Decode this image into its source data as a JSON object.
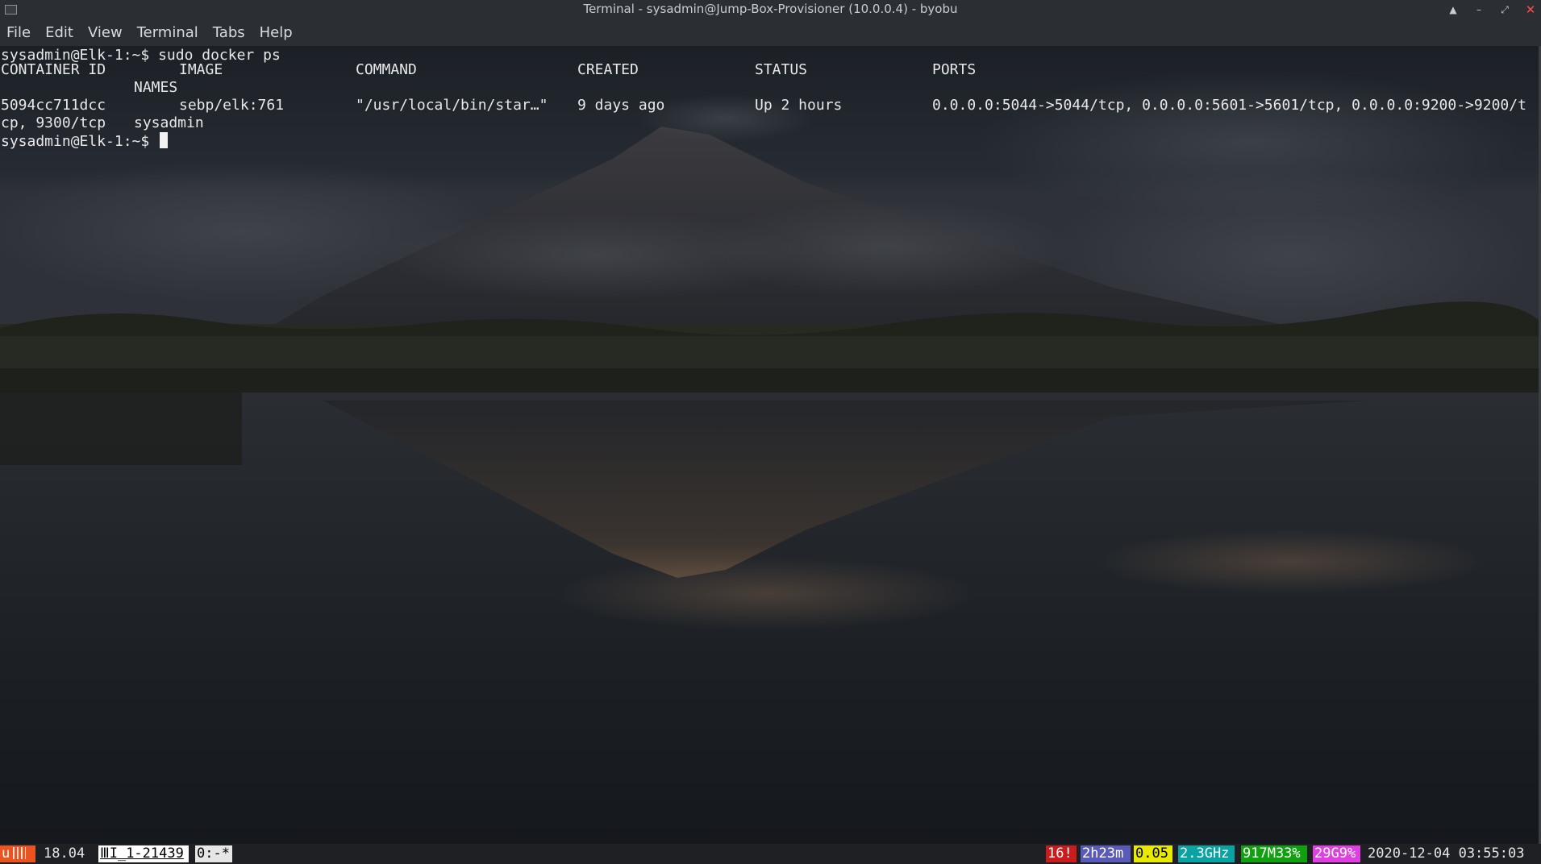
{
  "window": {
    "title": "Terminal - sysadmin@Jump-Box-Provisioner (10.0.0.4) - byobu",
    "buttons": {
      "up": "▲",
      "minimize": "–",
      "maximize": "⤢",
      "close": "✕"
    }
  },
  "menu": [
    "File",
    "Edit",
    "View",
    "Terminal",
    "Tabs",
    "Help"
  ],
  "terminal": {
    "prompt1": "sysadmin@Elk-1:~$ sudo docker ps",
    "headers": {
      "container_id": "CONTAINER ID",
      "image": "IMAGE",
      "command": "COMMAND",
      "created": "CREATED",
      "status": "STATUS",
      "ports": "PORTS",
      "names": "NAMES"
    },
    "row": {
      "container_id": "5094cc711dcc",
      "image": "sebp/elk:761",
      "command": "\"/usr/local/bin/star…\"",
      "created": "9 days ago",
      "status": "Up 2 hours",
      "ports": "0.0.0.0:5044->5044/tcp, 0.0.0.0:5601->5601/tcp, 0.0.0.0:9200->9200/t",
      "ports_wrap": "cp, 9300/tcp",
      "names": "sysadmin"
    },
    "prompt2": "sysadmin@Elk-1:~$ "
  },
  "statusbar": {
    "logo": "u",
    "version": "18.04",
    "session": "ⅢI_1-21439",
    "window_tab": "0:-*",
    "updates": "16!",
    "uptime": "2h23m",
    "load": "0.05",
    "cpu": "2.3GHz",
    "memory": "917M33%",
    "disk": "29G9%",
    "datetime": "2020-12-04 03:55:03",
    "colors": {
      "logo_bg": "#e95420",
      "updates_bg": "#c91c1c",
      "uptime_bg": "#5a5ab8",
      "load_bg": "#e8e800",
      "cpu_bg": "#0aa3a3",
      "memory_bg": "#10a010",
      "disk_bg": "#e040e0"
    }
  }
}
